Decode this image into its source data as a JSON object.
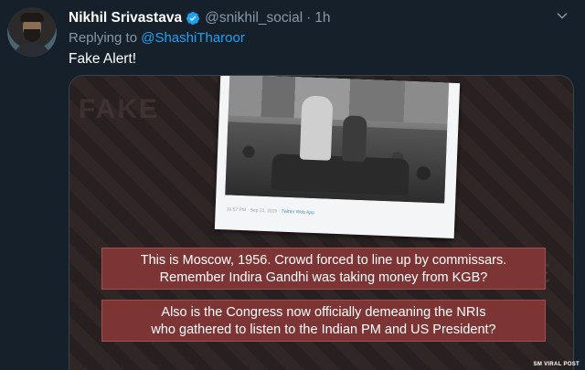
{
  "tweet": {
    "author_name": "Nikhil Srivastava",
    "handle": "@snikhil_social",
    "separator": "·",
    "time": "1h",
    "replying_prefix": "Replying to",
    "replying_to": "@ShashiTharoor",
    "text": "Fake Alert!"
  },
  "media": {
    "photo_caption_time": "10:57 PM · Sep 23, 2019 ·",
    "photo_caption_source": "Twitter Web App",
    "banner1_line1": "This is Moscow, 1956. Crowd forced to line up by commissars.",
    "banner1_line2": "Remember Indira Gandhi was taking money from KGB?",
    "banner2_line1": "Also is the Congress now officially demeaning the NRIs",
    "banner2_line2": "who gathered to listen to the Indian PM and US President?",
    "credit": "SM VIRAL POST",
    "watermark": "FAKE"
  },
  "colors": {
    "background": "#15202b",
    "muted": "#8899a6",
    "link": "#1da1f2",
    "verified": "#1da1f2",
    "banner": "#7d3434"
  },
  "icons": {
    "verified": "verified-badge-icon",
    "more": "chevron-down-icon"
  }
}
